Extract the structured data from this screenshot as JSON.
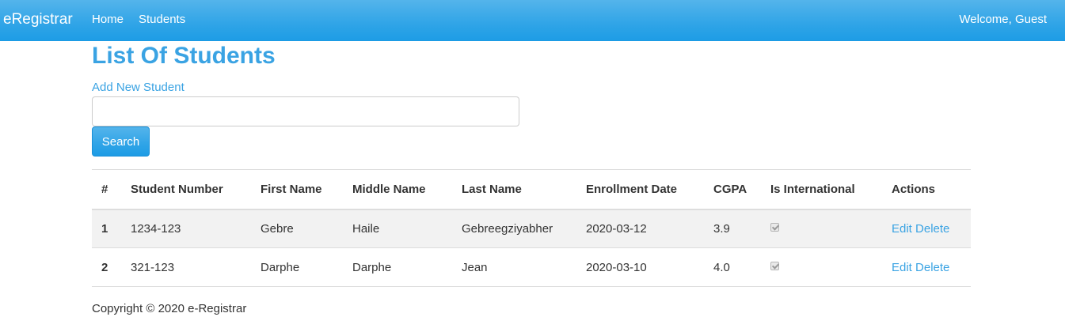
{
  "navbar": {
    "brand": "eRegistrar",
    "links": [
      "Home",
      "Students"
    ],
    "welcome": "Welcome, Guest"
  },
  "page": {
    "title": "List Of Students",
    "add_link": "Add New Student"
  },
  "search": {
    "value": "",
    "placeholder": "",
    "button_label": "Search"
  },
  "table": {
    "headers": [
      "#",
      "Student Number",
      "First Name",
      "Middle Name",
      "Last Name",
      "Enrollment Date",
      "CGPA",
      "Is International",
      "Actions"
    ],
    "rows": [
      {
        "index": "1",
        "student_number": "1234-123",
        "first_name": "Gebre",
        "middle_name": "Haile",
        "last_name": "Gebreegziyabher",
        "enrollment_date": "2020-03-12",
        "cgpa": "3.9",
        "is_international": true,
        "edit": "Edit",
        "delete": "Delete"
      },
      {
        "index": "2",
        "student_number": "321-123",
        "first_name": "Darphe",
        "middle_name": "Darphe",
        "last_name": "Jean",
        "enrollment_date": "2020-03-10",
        "cgpa": "4.0",
        "is_international": true,
        "edit": "Edit",
        "delete": "Delete"
      }
    ]
  },
  "footer": {
    "copyright": "Copyright © 2020 e-Registrar"
  },
  "colors": {
    "accent": "#2fa4e7",
    "link": "#3aa3e3"
  }
}
